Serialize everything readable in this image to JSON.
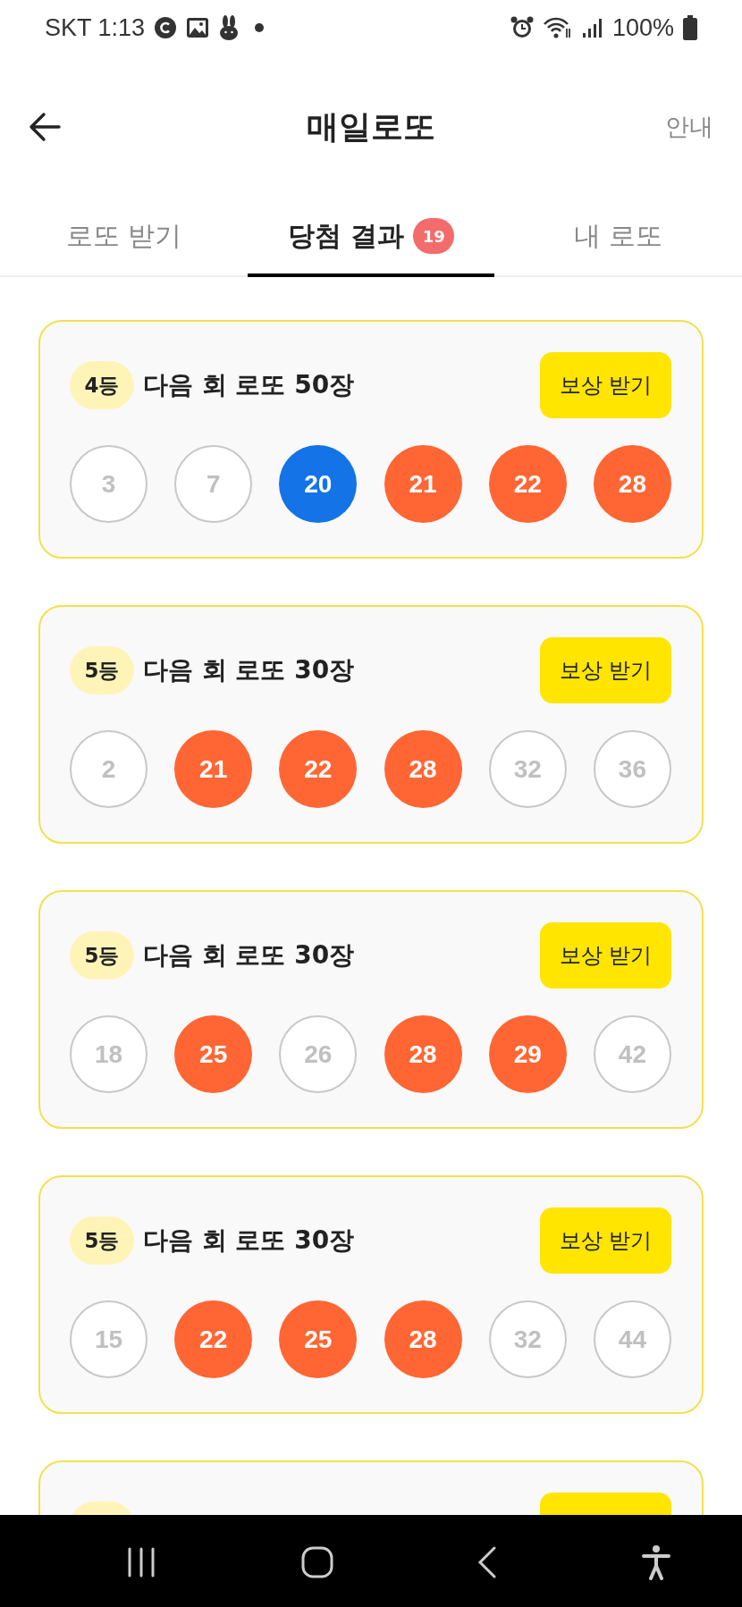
{
  "status_bar": {
    "carrier_time": "SKT 1:13",
    "battery": "100%"
  },
  "header": {
    "title": "매일로또",
    "action": "안내"
  },
  "tabs": [
    {
      "label": "로또 받기",
      "selected": false
    },
    {
      "label": "당첨 결과",
      "selected": true,
      "badge": "19"
    },
    {
      "label": "내 로또",
      "selected": false
    }
  ],
  "results": [
    {
      "rank": "4등",
      "prize": "다음 회 로또 50장",
      "button": "보상 받기",
      "numbers": [
        {
          "value": "3",
          "kind": "missed"
        },
        {
          "value": "7",
          "kind": "missed"
        },
        {
          "value": "20",
          "kind": "bonus"
        },
        {
          "value": "21",
          "kind": "matched"
        },
        {
          "value": "22",
          "kind": "matched"
        },
        {
          "value": "28",
          "kind": "matched"
        }
      ]
    },
    {
      "rank": "5등",
      "prize": "다음 회 로또 30장",
      "button": "보상 받기",
      "numbers": [
        {
          "value": "2",
          "kind": "missed"
        },
        {
          "value": "21",
          "kind": "matched"
        },
        {
          "value": "22",
          "kind": "matched"
        },
        {
          "value": "28",
          "kind": "matched"
        },
        {
          "value": "32",
          "kind": "missed"
        },
        {
          "value": "36",
          "kind": "missed"
        }
      ]
    },
    {
      "rank": "5등",
      "prize": "다음 회 로또 30장",
      "button": "보상 받기",
      "numbers": [
        {
          "value": "18",
          "kind": "missed"
        },
        {
          "value": "25",
          "kind": "matched"
        },
        {
          "value": "26",
          "kind": "missed"
        },
        {
          "value": "28",
          "kind": "matched"
        },
        {
          "value": "29",
          "kind": "matched"
        },
        {
          "value": "42",
          "kind": "missed"
        }
      ]
    },
    {
      "rank": "5등",
      "prize": "다음 회 로또 30장",
      "button": "보상 받기",
      "numbers": [
        {
          "value": "15",
          "kind": "missed"
        },
        {
          "value": "22",
          "kind": "matched"
        },
        {
          "value": "25",
          "kind": "matched"
        },
        {
          "value": "28",
          "kind": "matched"
        },
        {
          "value": "32",
          "kind": "missed"
        },
        {
          "value": "44",
          "kind": "missed"
        }
      ]
    },
    {
      "kind": "cut_off"
    }
  ]
}
